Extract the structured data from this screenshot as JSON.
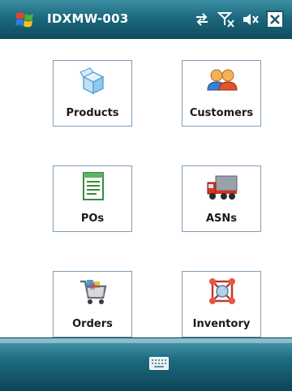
{
  "titlebar": {
    "title": "IDXMW-003",
    "start_icon": "windows-flag-icon",
    "status_icons": [
      "connectivity-icon",
      "signal-off-icon",
      "volume-off-icon"
    ],
    "close_icon": "close-icon"
  },
  "tiles": [
    {
      "label": "Products",
      "icon": "products-box-icon"
    },
    {
      "label": "Customers",
      "icon": "customers-people-icon"
    },
    {
      "label": "POs",
      "icon": "purchase-order-document-icon"
    },
    {
      "label": "ASNs",
      "icon": "shipping-truck-icon"
    },
    {
      "label": "Orders",
      "icon": "shopping-cart-icon"
    },
    {
      "label": "Inventory",
      "icon": "inventory-network-icon"
    }
  ],
  "bottombar": {
    "keyboard_icon": "keyboard-icon"
  },
  "colors": {
    "title_bar": "#1d6a80",
    "tile_border": "#7f9db9",
    "background": "#ffffff"
  }
}
